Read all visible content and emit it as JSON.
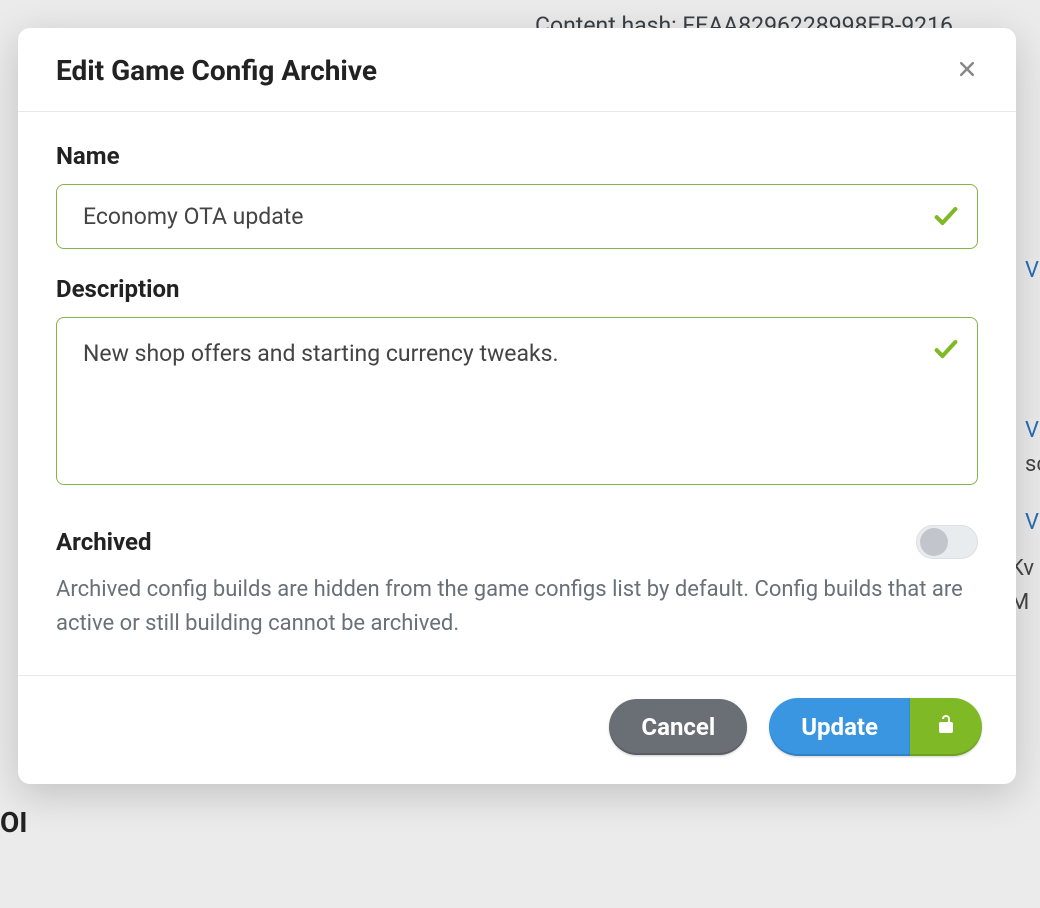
{
  "backdrop": {
    "hash_line": "Content hash: FEAA8296228998EB-9216",
    "frag_vi1": "Vi",
    "frag_vi2": "Vi",
    "frag_sc": "sc",
    "frag_vi3": "Vi",
    "frag_kv": "Kv",
    "frag_m": "M",
    "frag_oi": "OI"
  },
  "modal": {
    "title": "Edit Game Config Archive",
    "close_label": "Close"
  },
  "form": {
    "name": {
      "label": "Name",
      "value": "Economy OTA update",
      "valid": true
    },
    "description": {
      "label": "Description",
      "value": "New shop offers and starting currency tweaks.",
      "valid": true
    },
    "archived": {
      "label": "Archived",
      "value": false,
      "help": "Archived config builds are hidden from the game configs list by default. Config builds that are active or still building cannot be archived."
    }
  },
  "footer": {
    "cancel": "Cancel",
    "update": "Update"
  }
}
